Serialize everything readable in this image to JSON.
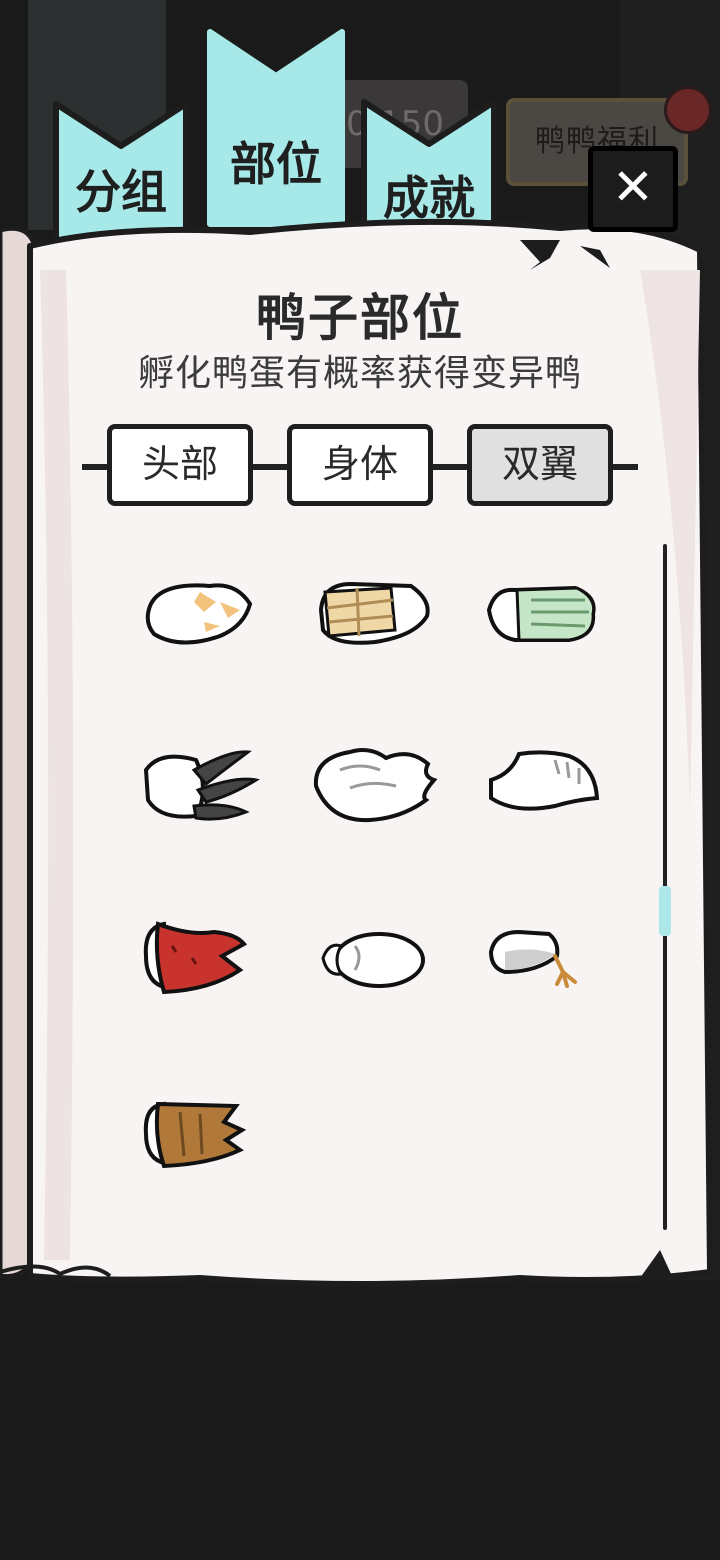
{
  "tabs": [
    {
      "label": "分组"
    },
    {
      "label": "部位"
    },
    {
      "label": "成就"
    }
  ],
  "background": {
    "counter_text": "0/150",
    "welfare_label": "鸭鸭福利"
  },
  "close_label": "✕",
  "header": {
    "title": "鸭子部位",
    "subtitle": "孵化鸭蛋有概率获得变异鸭"
  },
  "segments": [
    {
      "label": "头部"
    },
    {
      "label": "身体"
    },
    {
      "label": "双翼",
      "selected": true
    }
  ],
  "items": [
    {
      "icon": "orange-spot-wing-icon"
    },
    {
      "icon": "bandaged-wing-icon"
    },
    {
      "icon": "green-glove-wing-icon"
    },
    {
      "icon": "black-claw-wing-icon"
    },
    {
      "icon": "feathered-white-wing-icon"
    },
    {
      "icon": "slim-white-wing-icon"
    },
    {
      "icon": "red-sleeve-wing-icon"
    },
    {
      "icon": "egg-wing-icon"
    },
    {
      "icon": "grey-bird-claw-wing-icon"
    },
    {
      "icon": "brown-sleeve-wing-icon"
    }
  ],
  "colors": {
    "tab": "#a7e9e9",
    "paper": "#f8f4f3",
    "outline": "#1d1d1d",
    "scroll_thumb": "#aee7ea"
  }
}
